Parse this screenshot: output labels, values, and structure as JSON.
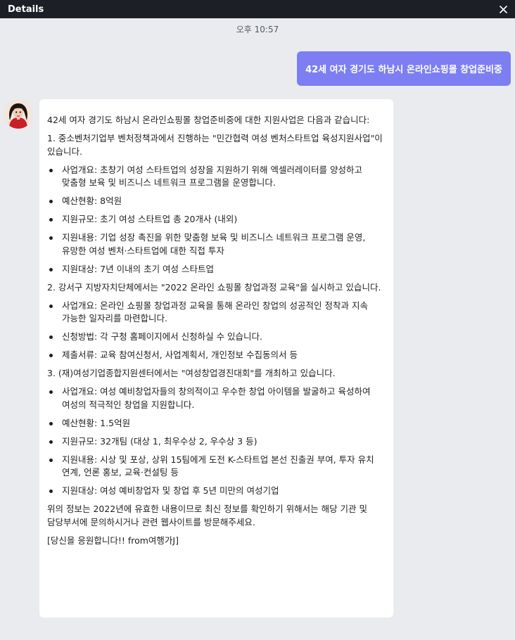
{
  "window": {
    "title": "Details",
    "close_icon": "close-icon"
  },
  "chat": {
    "timestamp": "오후 10:57",
    "user_message": "42세 여자 경기도 하남시 온라인쇼핑몰 창업준비중",
    "assistant_avatar": "avatar-illustration",
    "assistant_message": {
      "intro": "42세 여자 경기도 하남시 온라인쇼핑몰 창업준비중에 대한 지원사업은 다음과 같습니다:",
      "section1_heading": "1. 중소벤처기업부 벤처정책과에서 진행하는 \"민간협력 여성 벤처스타트업 육성지원사업\"이 있습니다.",
      "section1_items": [
        "사업개요: 초창기 여성 스타트업의 성장을 지원하기 위해 엑셀러레이터를 양성하고 맞춤형 보육 및 비즈니스 네트워크 프로그램을 운영합니다.",
        "예산현황: 8억원",
        "지원규모: 초기 여성 스타트업 총 20개사 (내외)",
        "지원내용: 기업 성장 촉진을 위한 맞춤형 보육 및 비즈니스 네트워크 프로그램 운영, 유망한 여성 벤처·스타트업에 대한 직접 투자",
        "지원대상: 7년 이내의 초기 여성 스타트업"
      ],
      "section2_heading": "2. 강서구 지방자치단체에서는 \"2022 온라인 쇼핑몰 창업과정 교육\"을 실시하고 있습니다.",
      "section2_items": [
        "사업개요: 온라인 쇼핑몰 창업과정 교육을 통해 온라인 창업의 성공적인 정착과 지속 가능한 일자리를 마련합니다.",
        "신청방법: 각 구청 홈페이지에서 신청하실 수 있습니다.",
        "제출서류: 교육 참여신청서, 사업계획서, 개인정보 수집동의서 등"
      ],
      "section3_heading": "3. (재)여성기업종합지원센터에서는 \"여성창업경진대회\"를 개최하고 있습니다.",
      "section3_items": [
        "사업개요: 여성 예비창업자들의 창의적이고 우수한 창업 아이템을 발굴하고 육성하여 여성의 적극적인 창업을 지원합니다.",
        "예산현황: 1.5억원",
        "지원규모: 32개팀 (대상 1, 최우수상 2, 우수상 3 등)",
        "지원내용: 시상 및 포상, 상위 15팀에게 도전 K-스타트업 본선 진출권 부여, 투자 유치 연계, 언론 홍보, 교육·컨설팅 등",
        "지원대상: 여성 예비창업자 및 창업 후 5년 미만의 여성기업"
      ],
      "closing": "위의 정보는 2022년에 유효한 내용이므로 최신 정보를 확인하기 위해서는 해당 기관 및 담당부서에 문의하시거나 관련 웹사이트를 방문해주세요.",
      "signoff": "[당신을 응원합니다!! from여행가J]"
    }
  },
  "colors": {
    "titlebar_bg": "#1c1f25",
    "background": "#e9ebee",
    "user_bubble": "#7c7ef2",
    "bot_bubble": "#ffffff"
  }
}
